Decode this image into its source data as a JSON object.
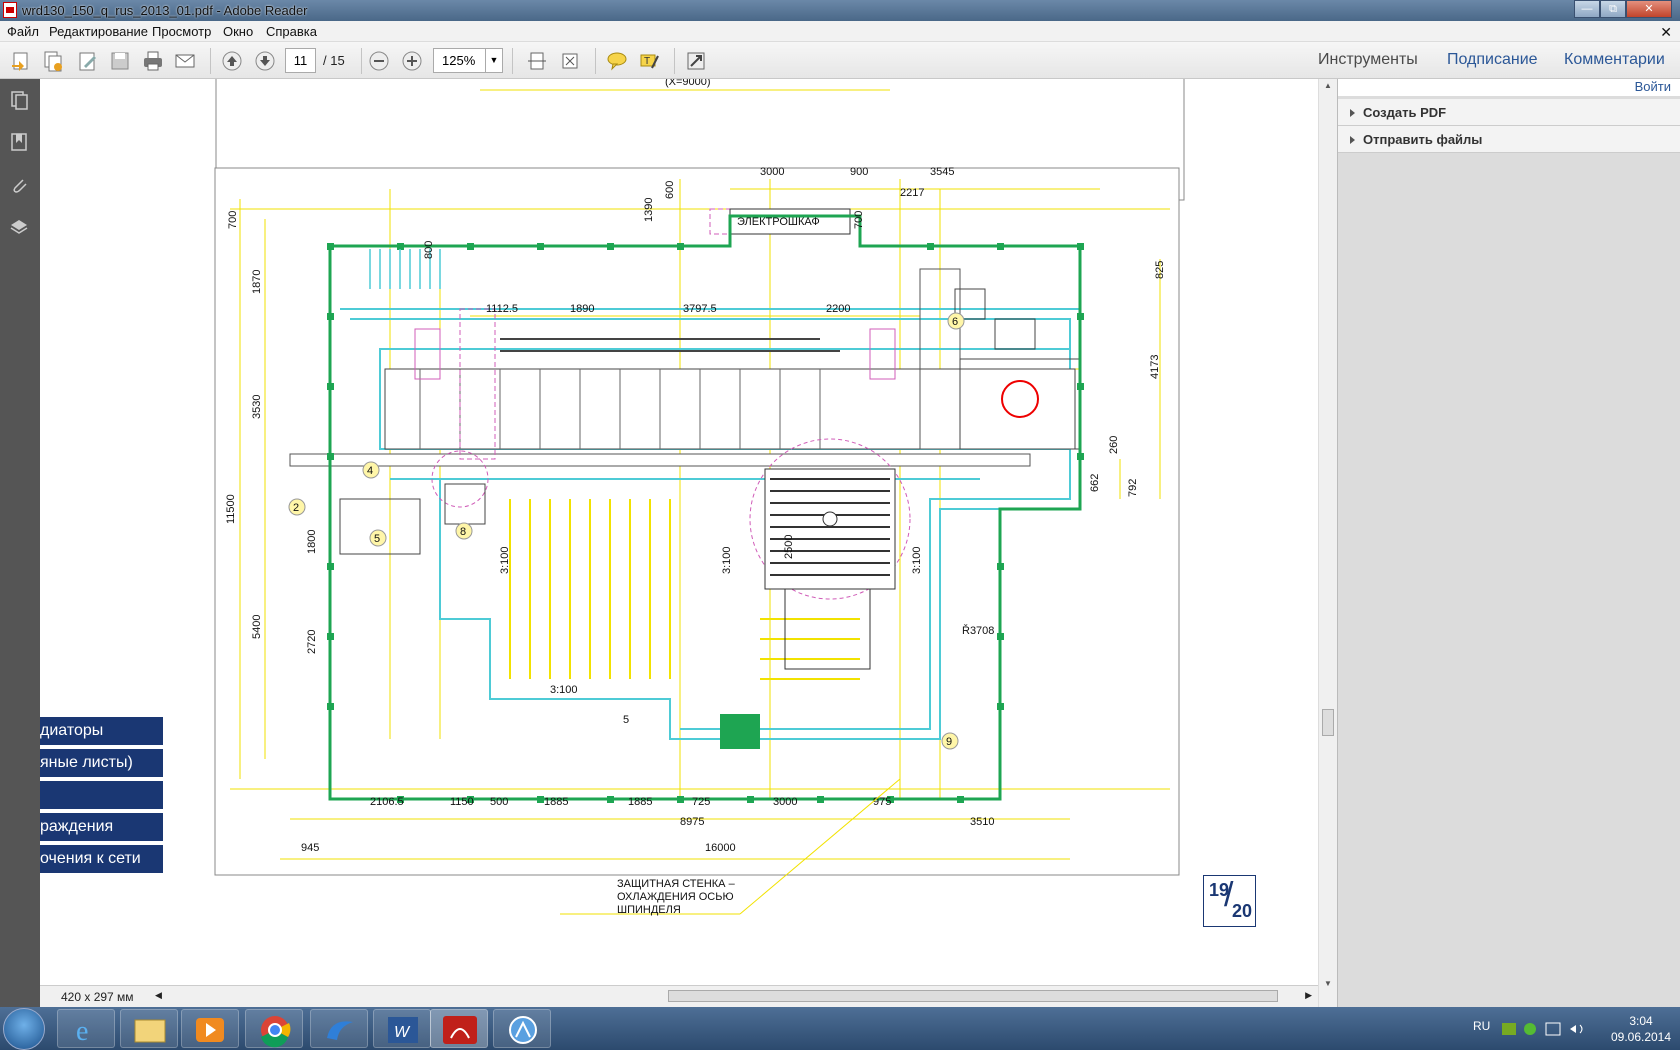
{
  "window": {
    "title": "wrd130_150_q_rus_2013_01.pdf - Adobe Reader"
  },
  "menu": {
    "file": "Файл",
    "edit": "Редактирование",
    "view": "Просмотр",
    "window": "Окно",
    "help": "Справка"
  },
  "toolbar": {
    "page_current": "11",
    "page_total": "/ 15",
    "zoom": "125%"
  },
  "right_tabs": {
    "tools": "Инструменты",
    "sign": "Подписание",
    "comments": "Комментарии"
  },
  "right_panel": {
    "login": "Войти",
    "create_pdf": "Создать PDF",
    "send_files": "Отправить файлы"
  },
  "status": {
    "page_size": "420 x 297 мм"
  },
  "overlay_items": [
    "диаторы",
    "яные листы)",
    "",
    "раждения",
    "очения к сети"
  ],
  "drawing": {
    "top_dim": "(X=9000)",
    "cabinet": "ЭЛЕКТРОШКАФ",
    "top_dims": [
      "3000",
      "900",
      "3545",
      "2217",
      "1390",
      "600",
      "700",
      "700",
      "800"
    ],
    "mid_dims": [
      "1112.5",
      "1890",
      "3797.5",
      "2200"
    ],
    "left_dims": [
      "700",
      "1870",
      "3530",
      "11500",
      "1800",
      "2720",
      "5400"
    ],
    "right_dims": [
      "825",
      "4173",
      "260",
      "662",
      "792"
    ],
    "center_dims": [
      "3:100",
      "3:100",
      "2500",
      "3:100",
      "3:100",
      "5",
      "Ř3708"
    ],
    "bottom_dims_row1": [
      "2106.5",
      "1150",
      "500",
      "1885",
      "1885",
      "725",
      "3000",
      "975"
    ],
    "bottom_dims_row2": [
      "8975",
      "3510"
    ],
    "bottom_dims_row3": [
      "945",
      "16000"
    ],
    "markers": [
      "2",
      "4",
      "5",
      "6",
      "8",
      "9"
    ],
    "callout": "ЗАЩИТНАЯ СТЕНКА –\nОХЛАЖДЕНИЯ ОСЬЮ\nШПИНДЕЛЯ",
    "page_badge_num": "19",
    "page_badge_den": "20"
  },
  "taskbar": {
    "lang": "RU",
    "time": "3:04",
    "date": "09.06.2014"
  },
  "colors": {
    "green_wall": "#1ea552",
    "cyan": "#4ecbd6",
    "yellow": "#f2e200",
    "magenta": "#d05cb8",
    "navy": "#1a3773"
  }
}
